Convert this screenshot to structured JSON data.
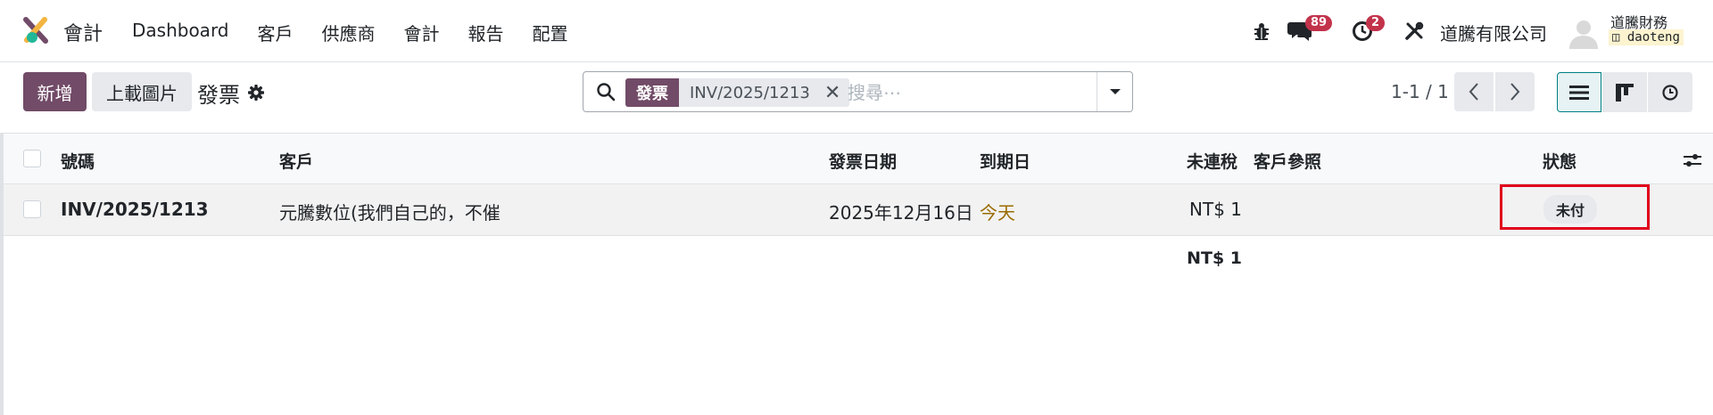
{
  "app": {
    "name": "會計"
  },
  "nav": {
    "items": [
      "Dashboard",
      "客戶",
      "供應商",
      "會計",
      "報告",
      "配置"
    ]
  },
  "systray": {
    "messages_count": "89",
    "activities_count": "2",
    "company": "道騰有限公司",
    "user_name": "道騰財務",
    "database": "daoteng"
  },
  "control": {
    "new_label": "新增",
    "upload_label": "上載圖片",
    "breadcrumb": "發票"
  },
  "search": {
    "facet_category": "發票",
    "facet_value": "INV/2025/1213",
    "placeholder": "搜尋⋯"
  },
  "pager": {
    "value": "1-1 / 1"
  },
  "list": {
    "columns": {
      "number": "號碼",
      "customer": "客戶",
      "invoice_date": "發票日期",
      "due_date": "到期日",
      "untaxed": "未連稅",
      "customer_ref": "客戶參照",
      "status": "狀態"
    },
    "rows": [
      {
        "number": "INV/2025/1213",
        "customer": "元騰數位(我們自己的，不催",
        "invoice_date": "2025年12月16日",
        "due_date": "今天",
        "untaxed": "NT$ 1",
        "customer_ref": "",
        "status": "未付"
      }
    ],
    "total_untaxed": "NT$ 1"
  },
  "colors": {
    "brand": "#714b67",
    "badge": "#c2334b",
    "due_today": "#9a6b01",
    "highlight": "#e0001b"
  }
}
